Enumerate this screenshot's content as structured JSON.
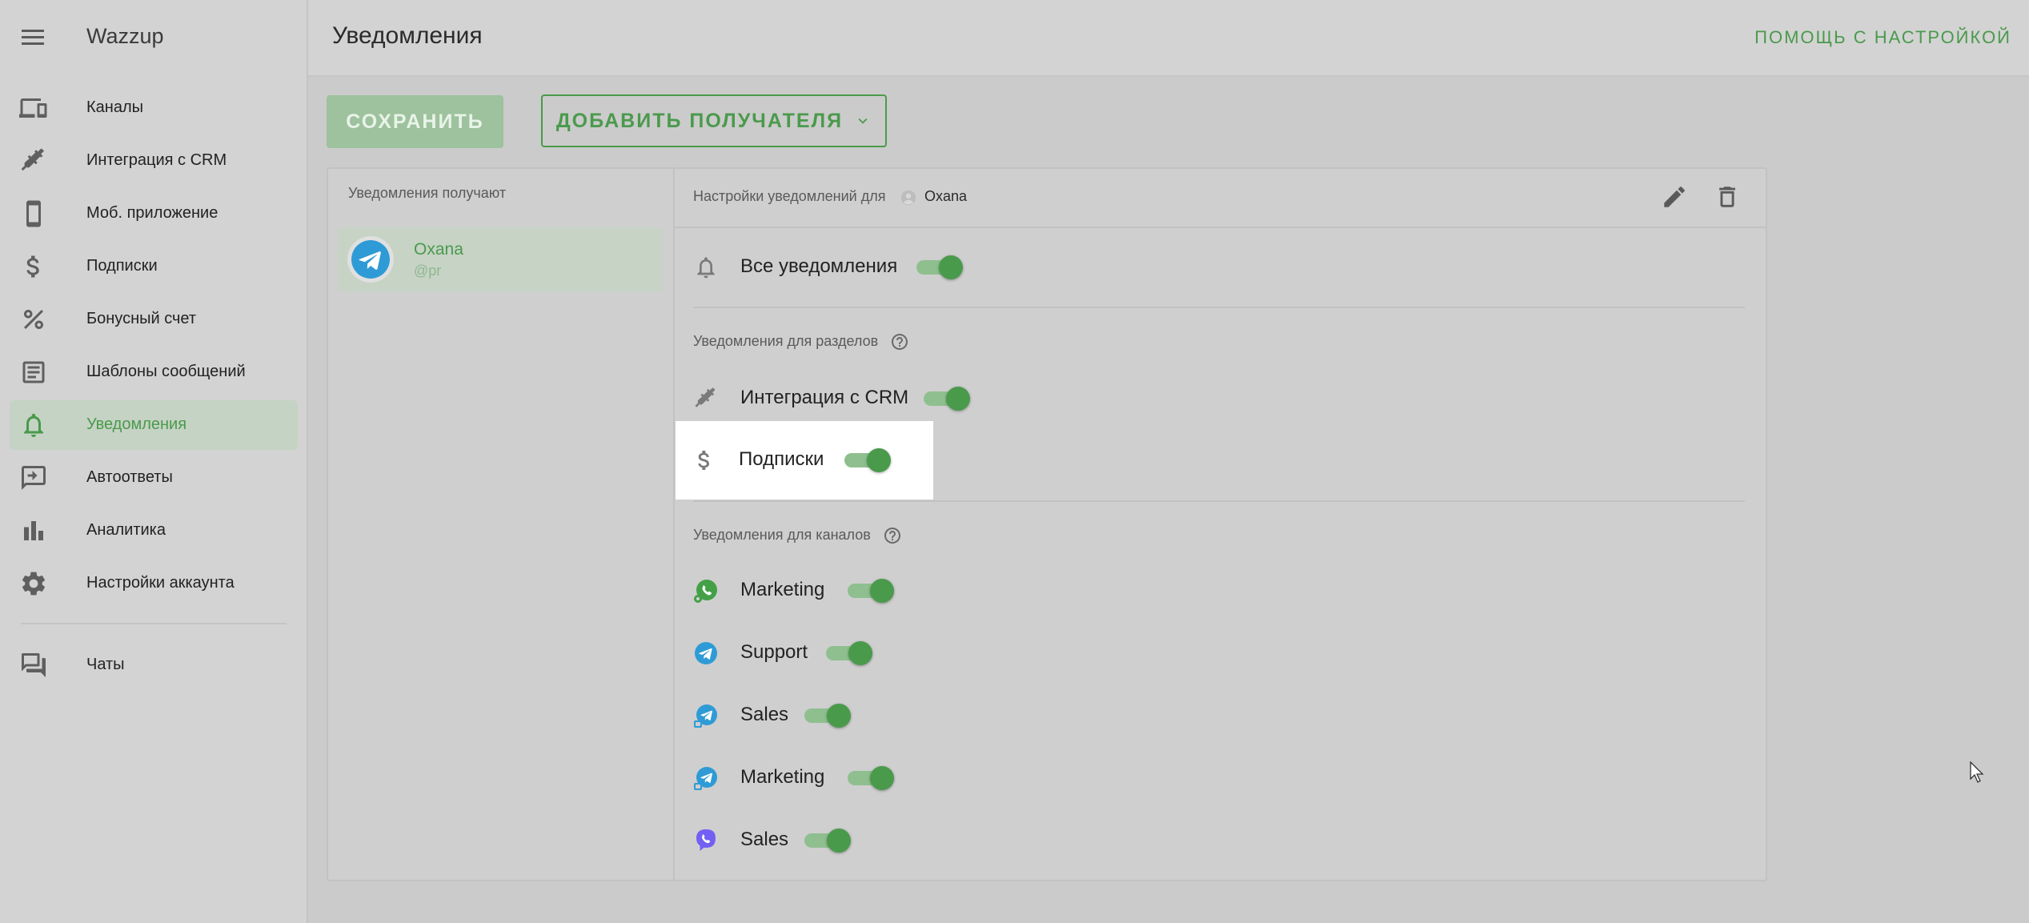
{
  "sidebar": {
    "brand": "Wazzup",
    "items": [
      {
        "label": "Каналы",
        "icon": "devices-icon"
      },
      {
        "label": "Интеграция с CRM",
        "icon": "plug-icon"
      },
      {
        "label": "Моб. приложение",
        "icon": "phone-icon"
      },
      {
        "label": "Подписки",
        "icon": "dollar-icon"
      },
      {
        "label": "Бонусный счет",
        "icon": "percent-icon"
      },
      {
        "label": "Шаблоны сообщений",
        "icon": "template-icon"
      },
      {
        "label": "Уведомления",
        "icon": "bell-icon",
        "active": true
      },
      {
        "label": "Автоответы",
        "icon": "autoreply-icon"
      },
      {
        "label": "Аналитика",
        "icon": "chart-icon"
      },
      {
        "label": "Настройки аккаунта",
        "icon": "gear-icon"
      }
    ],
    "chats_label": "Чаты"
  },
  "header": {
    "title": "Уведомления",
    "help": "ПОМОЩЬ С НАСТРОЙКОЙ"
  },
  "toolbar": {
    "save_label": "СОХРАНИТЬ",
    "add_label": "ДОБАВИТЬ ПОЛУЧАТЕЛЯ"
  },
  "recipients": {
    "title": "Уведомления получают",
    "items": [
      {
        "name": "Oxana",
        "handle": "@pr",
        "channel": "telegram"
      }
    ]
  },
  "settings": {
    "title": "Настройки уведомлений для",
    "user": "Oxana",
    "all_label": "Все уведомления",
    "all_on": true,
    "sections_title": "Уведомления для разделов",
    "sections": [
      {
        "label": "Интеграция с CRM",
        "icon": "plug-icon",
        "on": true
      },
      {
        "label": "Подписки",
        "icon": "dollar-icon",
        "on": true
      }
    ],
    "channels_title": "Уведомления для каналов",
    "channels": [
      {
        "label": "Marketing",
        "icon": "whatsapp-icon",
        "on": true
      },
      {
        "label": "Support",
        "icon": "telegram-icon",
        "on": true
      },
      {
        "label": "Sales",
        "icon": "telegram-personal-icon",
        "on": true
      },
      {
        "label": "Marketing",
        "icon": "telegram-personal-icon",
        "on": true
      },
      {
        "label": "Sales",
        "icon": "viber-icon",
        "on": true
      }
    ]
  },
  "colors": {
    "accent": "#4a9a4c",
    "telegram": "#2f9bd6",
    "whatsapp": "#43a047",
    "viber": "#7360f2"
  }
}
